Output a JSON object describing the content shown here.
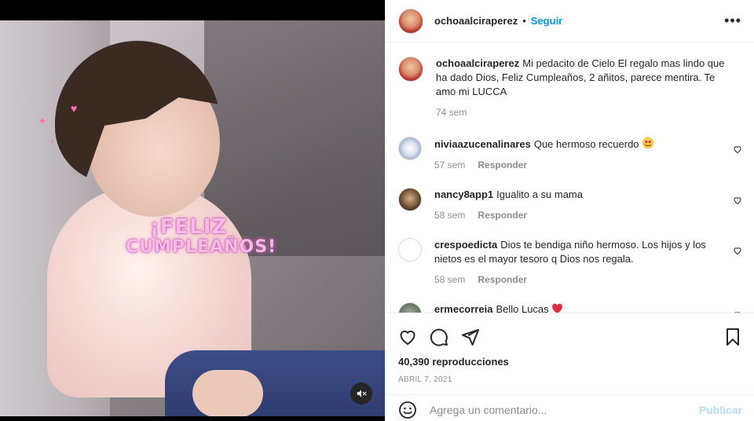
{
  "post": {
    "username": "ochoaalciraperez",
    "dot": "•",
    "follow_label": "Seguir",
    "more_label": "•••"
  },
  "media": {
    "overlay_line1": "¡FELIZ",
    "overlay_line2": "CUMPLEAÑOS!",
    "mute_icon": "volume-muted-icon"
  },
  "caption": {
    "username": "ochoaalciraperez",
    "text": "Mi pedacito de Cielo El regalo mas lindo que ha dado Dios, Feliz Cumpleaños, 2 añitos, parece mentira. Te amo mi LUCCA",
    "time": "74 sem"
  },
  "comments": [
    {
      "username": "niviaazucenalinares",
      "text": "Que hermoso recuerdo",
      "time": "57 sem",
      "reply_label": "Responder"
    },
    {
      "username": "nancy8app1",
      "text": "Igualito a su mama",
      "time": "58 sem",
      "reply_label": "Responder"
    },
    {
      "username": "crespoedicta",
      "text": "Dios te bendiga niño hermoso. Los hijos y los nietos es el mayor tesoro q Dios nos regala.",
      "time": "58 sem",
      "reply_label": "Responder"
    },
    {
      "username": "ermecorreia",
      "text": "Bello Lucas"
    }
  ],
  "stats": {
    "views": "40,390 reproducciones",
    "date": "ABRIL 7, 2021"
  },
  "add_comment": {
    "placeholder": "Agrega un comentario...",
    "publish_label": "Publicar"
  },
  "colors": {
    "accent": "#0095f6",
    "publish_disabled": "#b2dffc",
    "muted_text": "#8e8e8e",
    "heart_red": "#ed4956"
  }
}
